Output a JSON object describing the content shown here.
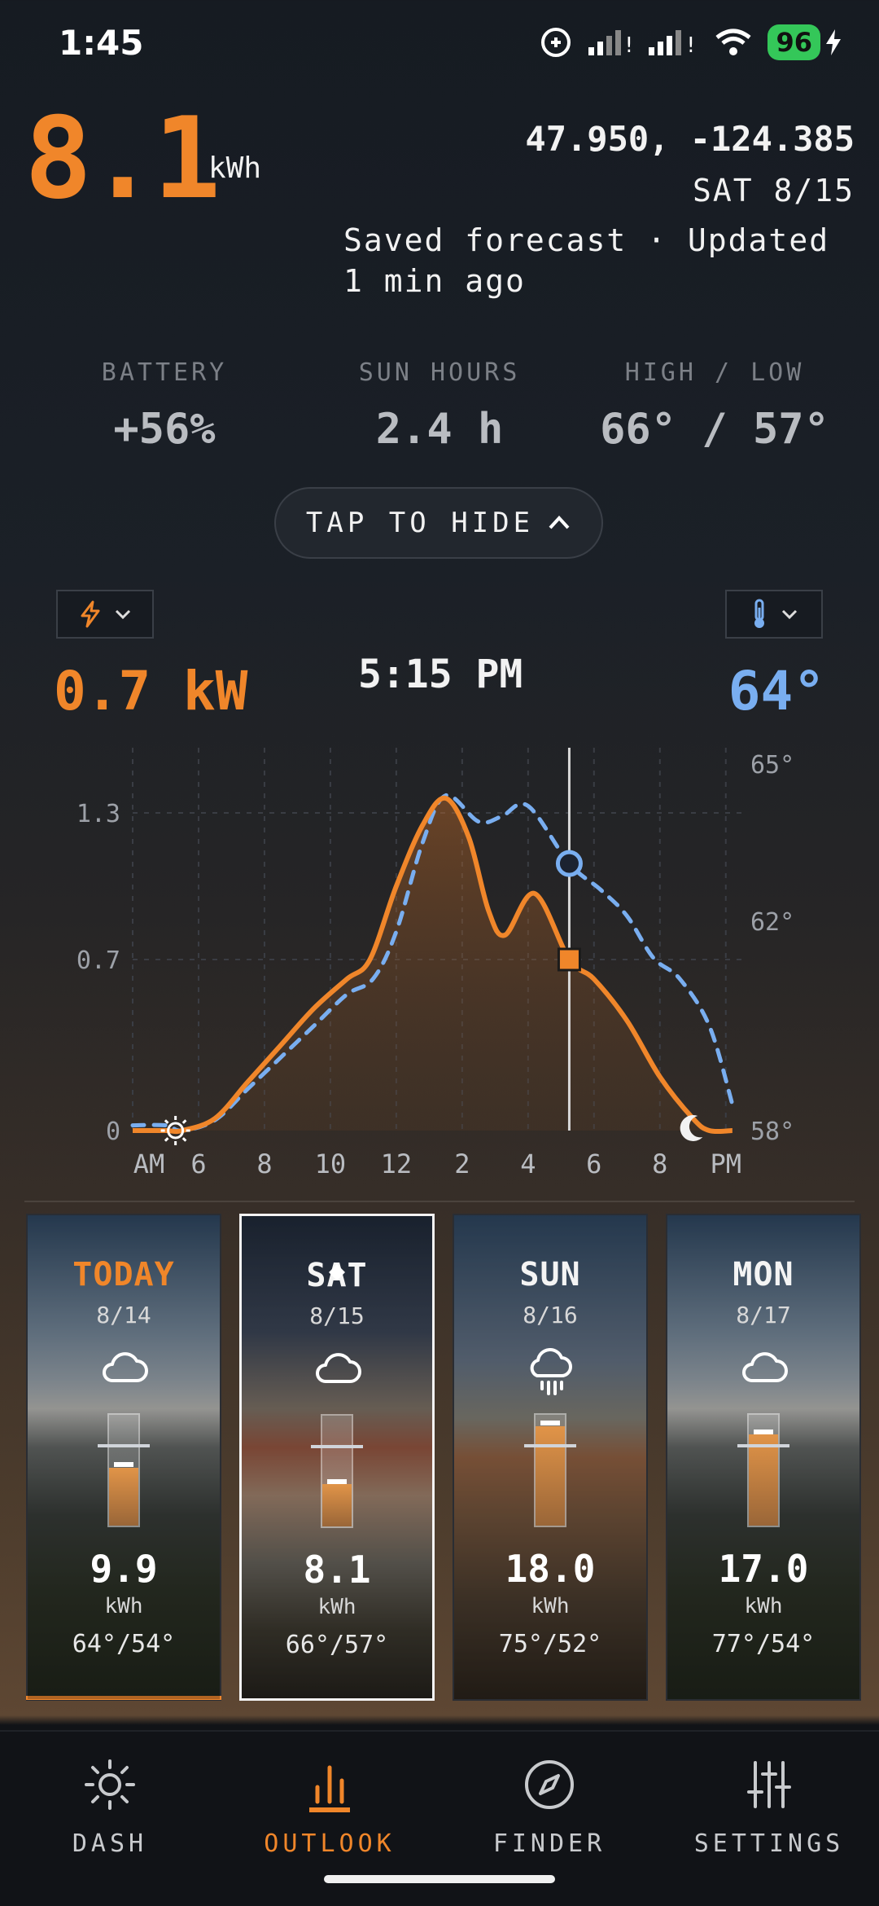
{
  "status_bar": {
    "time": "1:45",
    "battery": "96"
  },
  "header": {
    "energy_value": "8.1",
    "energy_unit": "kWh",
    "coordinates": "47.950, -124.385",
    "date": "SAT 8/15",
    "saved_status": "Saved forecast · Updated 1 min ago"
  },
  "stats": [
    {
      "label": "BATTERY",
      "value": "+56%"
    },
    {
      "label": "SUN HOURS",
      "value": "2.4 h"
    },
    {
      "label": "HIGH / LOW",
      "value": "66° / 57°"
    }
  ],
  "toggle_label": "TAP TO HIDE",
  "readout": {
    "power": "0.7 kW",
    "time": "5:15 PM",
    "temperature": "64°"
  },
  "chart_data": {
    "type": "line",
    "x_ticks": [
      "AM",
      "6",
      "8",
      "10",
      "12",
      "2",
      "4",
      "6",
      "8",
      "PM"
    ],
    "y_left_ticks": [
      "1.3",
      "0.7",
      "0"
    ],
    "y_right_ticks": [
      "65°",
      "62°",
      "58°"
    ],
    "ylim_left": [
      0,
      1.5
    ],
    "ylim_right": [
      58,
      65
    ],
    "cursor_hour": 17.25,
    "series": [
      {
        "color": "#f0862a",
        "dashed": false,
        "points": [
          [
            4,
            0
          ],
          [
            5,
            0
          ],
          [
            5.5,
            0
          ],
          [
            6.5,
            0.05
          ],
          [
            7.5,
            0.2
          ],
          [
            8.5,
            0.35
          ],
          [
            9.5,
            0.5
          ],
          [
            10.5,
            0.62
          ],
          [
            11.2,
            0.7
          ],
          [
            12,
            1.0
          ],
          [
            12.8,
            1.25
          ],
          [
            13.5,
            1.36
          ],
          [
            14.2,
            1.2
          ],
          [
            14.8,
            0.9
          ],
          [
            15.3,
            0.8
          ],
          [
            16.2,
            0.97
          ],
          [
            17.25,
            0.7
          ],
          [
            18,
            0.62
          ],
          [
            19,
            0.45
          ],
          [
            20,
            0.22
          ],
          [
            21,
            0.05
          ],
          [
            21.5,
            0
          ],
          [
            22.2,
            0
          ]
        ]
      },
      {
        "color": "#79aef0",
        "dashed": true,
        "points": [
          [
            4,
            58.1
          ],
          [
            5,
            58.1
          ],
          [
            5.5,
            58
          ],
          [
            6.5,
            58.2
          ],
          [
            7.5,
            58.8
          ],
          [
            8.5,
            59.4
          ],
          [
            9.5,
            60
          ],
          [
            10.5,
            60.6
          ],
          [
            11.3,
            60.9
          ],
          [
            12,
            61.8
          ],
          [
            12.8,
            63.5
          ],
          [
            13.5,
            64.4
          ],
          [
            14.5,
            63.9
          ],
          [
            15.2,
            64
          ],
          [
            16,
            64.2
          ],
          [
            17.25,
            63.1
          ],
          [
            18.2,
            62.6
          ],
          [
            19,
            62.1
          ],
          [
            19.8,
            61.3
          ],
          [
            20.6,
            60.9
          ],
          [
            21.5,
            60
          ],
          [
            22.2,
            58.5
          ]
        ]
      }
    ]
  },
  "days": [
    {
      "day": "TODAY",
      "date": "8/14",
      "icon": "cloud",
      "value": "9.9",
      "unit": "kWh",
      "range": "64°/54°",
      "fill": 0.52,
      "highlight": true
    },
    {
      "day": "SAT",
      "date": "8/15",
      "icon": "cloud",
      "value": "8.1",
      "unit": "kWh",
      "range": "66°/57°",
      "fill": 0.38,
      "selected": true
    },
    {
      "day": "SUN",
      "date": "8/16",
      "icon": "cloud-rain",
      "value": "18.0",
      "unit": "kWh",
      "range": "75°/52°",
      "fill": 0.9
    },
    {
      "day": "MON",
      "date": "8/17",
      "icon": "cloud",
      "value": "17.0",
      "unit": "kWh",
      "range": "77°/54°",
      "fill": 0.82
    }
  ],
  "tabs": [
    {
      "label": "DASH",
      "icon": "sun-icon"
    },
    {
      "label": "OUTLOOK",
      "icon": "bar-chart-icon",
      "active": true
    },
    {
      "label": "FINDER",
      "icon": "compass-icon"
    },
    {
      "label": "SETTINGS",
      "icon": "sliders-icon"
    }
  ],
  "colors": {
    "accent": "#f0862a",
    "temperature": "#79aef0",
    "active_tab": "#f0862a"
  }
}
